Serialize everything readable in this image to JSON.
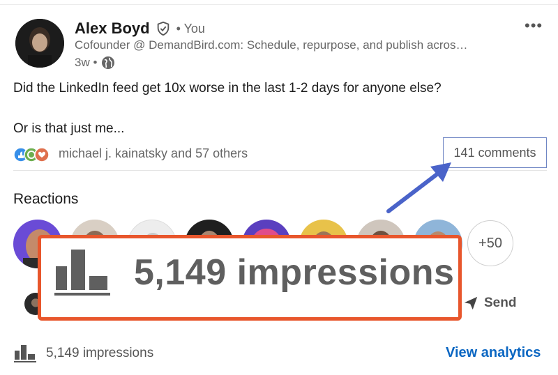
{
  "author": {
    "name": "Alex Boyd",
    "relation": "• You",
    "headline": "Cofounder @ DemandBird.com: Schedule, repurpose, and publish acros…",
    "time": "3w •"
  },
  "post": {
    "line1": "Did the LinkedIn feed get 10x worse in the last 1-2 days for anyone else?",
    "line2": "Or is that just me..."
  },
  "social": {
    "reactions_text": "michael j. kainatsky and 57 others",
    "comments": "141 comments"
  },
  "reactions": {
    "title": "Reactions",
    "more": "+50"
  },
  "actions": {
    "send": "Send"
  },
  "callout": {
    "text": "5,149 impressions"
  },
  "footer": {
    "impressions": "5,149 impressions",
    "view_analytics": "View analytics"
  },
  "colors": {
    "accent_link": "#0a66c2",
    "callout_border": "#e8562c",
    "arrow": "#4a63c9"
  }
}
